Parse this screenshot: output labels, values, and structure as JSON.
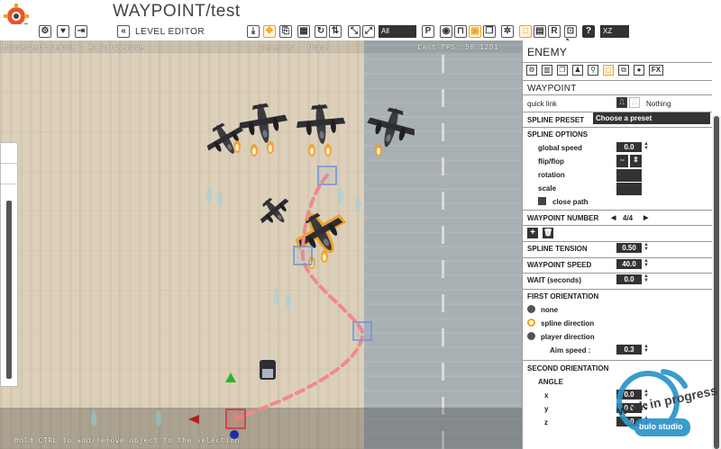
{
  "app": {
    "title": "WAYPOINT/test"
  },
  "toolbar": {
    "level_editor_label": "LEVEL EDITOR",
    "filter_value": "All",
    "axis_value": "XZ"
  },
  "viewport": {
    "hud_mouse": "MouseOverNodeName : RC_Spritenode",
    "hud_selected": "Selected : Nnoun",
    "hud_fps": "Last FPS: 58.1281",
    "hud_hint": "Hold CTRL to add/remove object to the selection"
  },
  "panel": {
    "enemy_header": "ENEMY",
    "tabs_icons": [
      "gear-icon",
      "map-icon",
      "copy-icon",
      "person-icon",
      "pin-icon",
      "waypoint-icon",
      "duplicate-icon",
      "bomb-icon",
      "fx-icon"
    ],
    "fx_label": "FX",
    "waypoint_header": "WAYPOINT",
    "quick_link_label": "quick link",
    "quick_link_value": "Nothing",
    "spline_preset_label": "SPLINE PRESET",
    "spline_preset_value": "Choose a preset",
    "spline_options_label": "SPLINE OPTIONS",
    "global_speed_label": "global speed",
    "global_speed_value": "0.0",
    "flip_flop_label": "flip/flop",
    "rotation_label": "rotation",
    "scale_label": "scale",
    "close_path_label": "close path",
    "waypoint_number_label": "WAYPOINT NUMBER",
    "waypoint_number_value": "4/4",
    "spline_tension_label": "SPLINE TENSION",
    "spline_tension_value": "0.50",
    "waypoint_speed_label": "WAYPOINT SPEED",
    "waypoint_speed_value": "40.0",
    "wait_label": "WAIT (seconds)",
    "wait_value": "0.0",
    "first_orientation_label": "FIRST ORIENTATION",
    "orientation_options": [
      "none",
      "spline direction",
      "player direction"
    ],
    "orientation_selected": "spline direction",
    "aim_speed_label": "Aim speed :",
    "aim_speed_value": "0.3",
    "second_orientation_label": "SECOND ORIENTATION",
    "angle_label": "ANGLE",
    "x_label": "x",
    "x_value": "0.0",
    "y_label": "y",
    "y_value": "0.0",
    "z_label": "z",
    "z_value": "0.0",
    "wip_text": "work in progress",
    "wip_brand": "bulo studio"
  },
  "colors": {
    "accent_orange": "#f2a21b",
    "spline_pink": "#f08a8a",
    "waypoint_blue": "#6f93d6",
    "panel_dark": "#333333"
  }
}
